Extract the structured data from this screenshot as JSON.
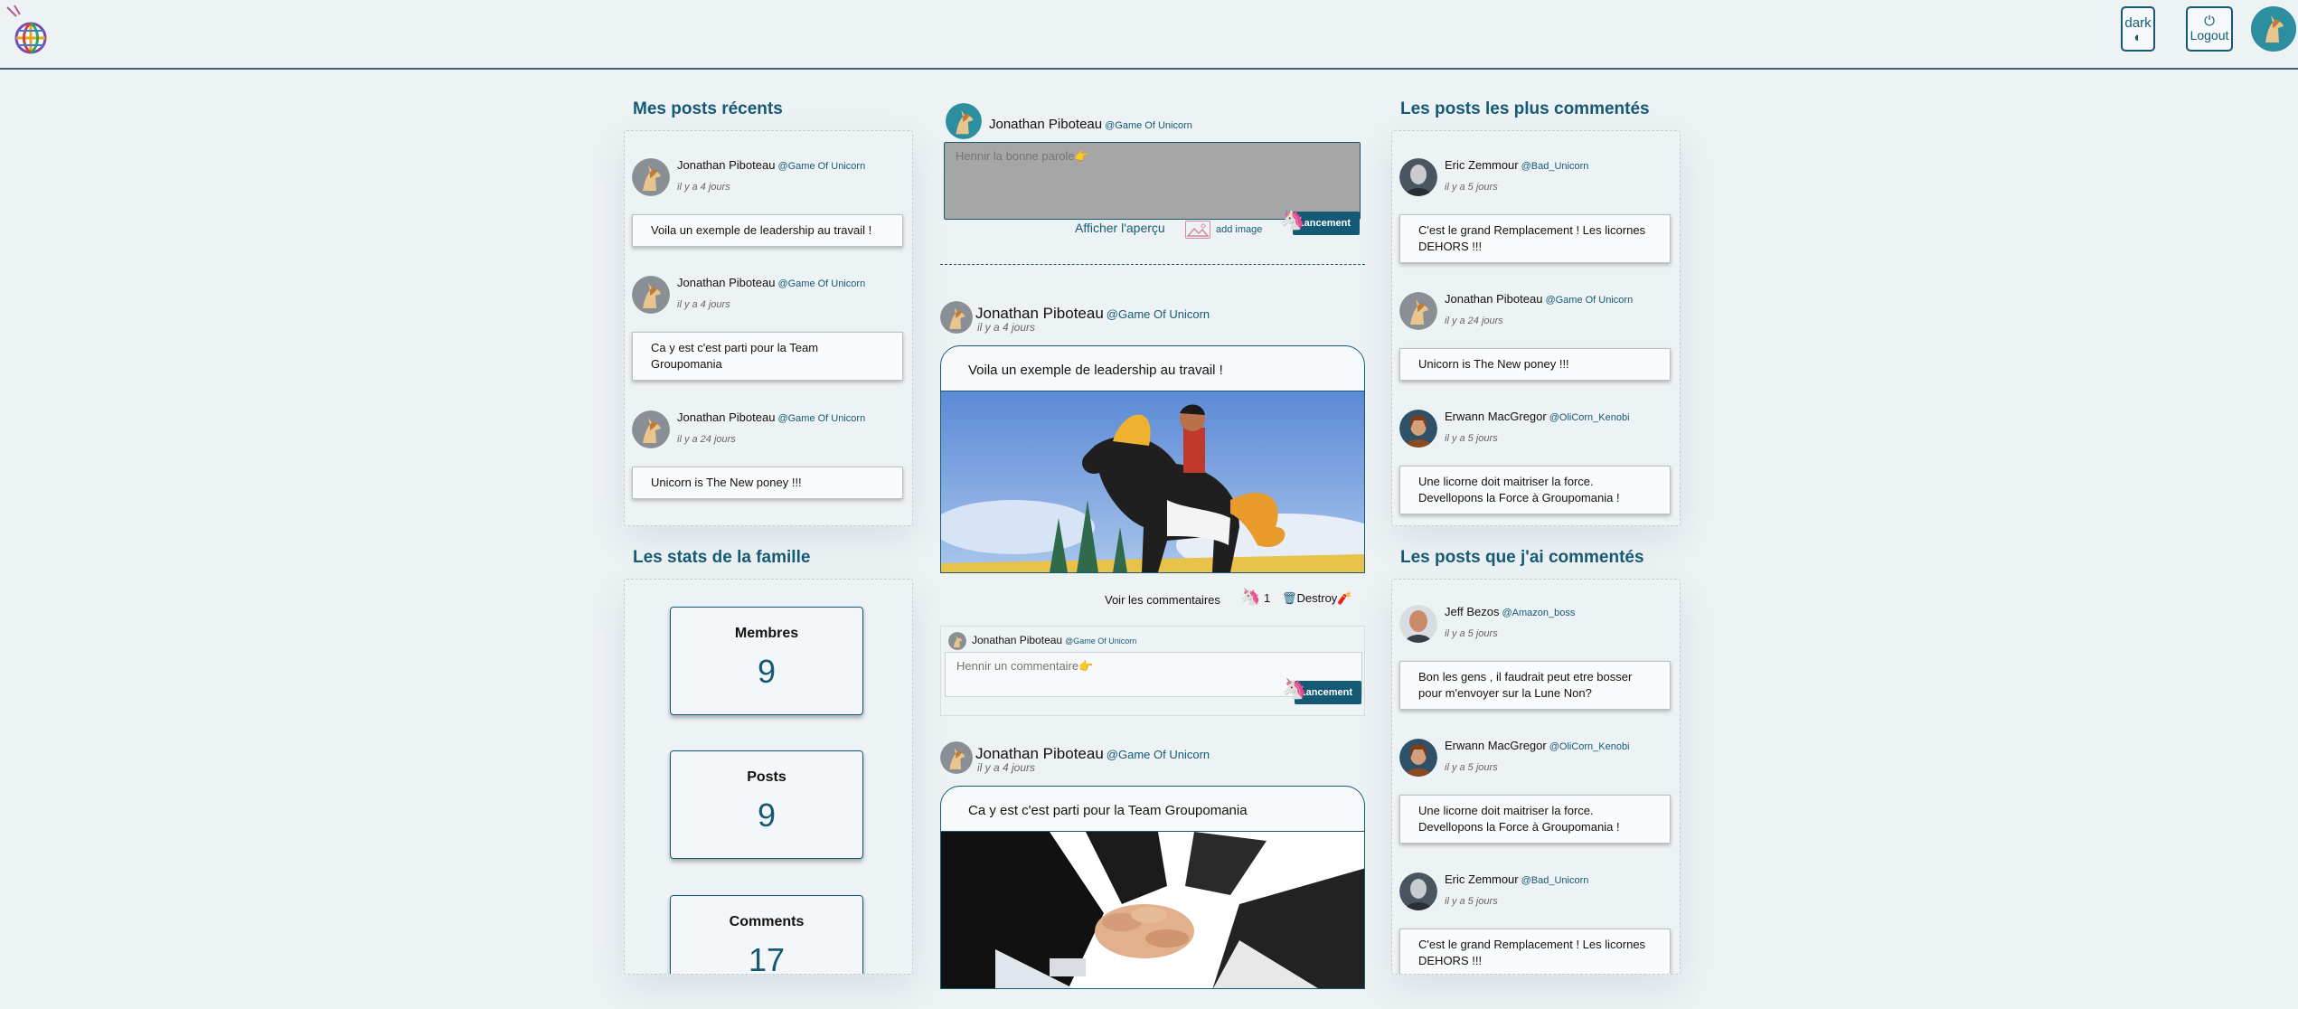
{
  "header": {
    "logo_icon": "globe-logo-icon",
    "dark_label": "dark",
    "dark_icon": "contrast-icon",
    "logout_label": "Logout",
    "logout_icon": "power-icon",
    "avatar_icon": "unicorn-avatar-icon"
  },
  "my_posts": {
    "title": "Mes posts récents",
    "items": [
      {
        "name": "Jonathan Piboteau",
        "handle": "@Game Of Unicorn",
        "time": "il y a 4 jours",
        "text": "Voila un exemple de leadership au travail !"
      },
      {
        "name": "Jonathan Piboteau",
        "handle": "@Game Of Unicorn",
        "time": "il y a 4 jours",
        "text": "Ca y est c'est parti pour la Team Groupomania"
      },
      {
        "name": "Jonathan Piboteau",
        "handle": "@Game Of Unicorn",
        "time": "il y a 24 jours",
        "text": "Unicorn is The New poney !!!"
      }
    ]
  },
  "stats": {
    "title": "Les stats de la famille",
    "members_label": "Membres",
    "members_value": "9",
    "posts_label": "Posts",
    "posts_value": "9",
    "comments_label": "Comments",
    "comments_value": "17"
  },
  "composer": {
    "name": "Jonathan Piboteau",
    "handle": "@Game Of Unicorn",
    "placeholder": "Hennir la bonne parole👉",
    "preview_label": "Afficher l'aperçu",
    "add_image_label": "add image",
    "submit_label": "Lancement"
  },
  "feed": [
    {
      "name": "Jonathan Piboteau",
      "handle": "@Game Of Unicorn",
      "time": "il y a 4 jours",
      "text": "Voila un exemple de leadership au travail !",
      "comments_label": "Voir les commentaires",
      "likes": "1",
      "destroy_label": "Destroy"
    },
    {
      "name": "Jonathan Piboteau",
      "handle": "@Game Of Unicorn",
      "time": "il y a 4 jours",
      "text": "Ca y est c'est parti pour la Team Groupomania"
    }
  ],
  "comment_box": {
    "name": "Jonathan Piboteau",
    "handle": "@Game Of Unicorn",
    "placeholder": "Hennir un commentaire👉",
    "submit_label": "Lancement"
  },
  "most_commented": {
    "title": "Les posts les plus commentés",
    "items": [
      {
        "name": "Eric Zemmour",
        "handle": "@Bad_Unicorn",
        "time": "il y a 5 jours",
        "text": "C'est le grand Remplacement ! Les licornes DEHORS !!!"
      },
      {
        "name": "Jonathan Piboteau",
        "handle": "@Game Of Unicorn",
        "time": "il y a 24 jours",
        "text": "Unicorn is The New poney !!!"
      },
      {
        "name": "Erwann MacGregor",
        "handle": "@OliCorn_Kenobi",
        "time": "il y a 5 jours",
        "text": "Une licorne doit maitriser la force. Devellopons la Force à Groupomania !"
      }
    ]
  },
  "my_comments": {
    "title": "Les posts que j'ai commentés",
    "items": [
      {
        "name": "Jeff Bezos",
        "handle": "@Amazon_boss",
        "time": "il y a 5 jours",
        "text": "Bon les gens , il faudrait peut etre bosser pour m'envoyer sur la Lune Non?"
      },
      {
        "name": "Erwann MacGregor",
        "handle": "@OliCorn_Kenobi",
        "time": "il y a 5 jours",
        "text": "Une licorne doit maitriser la force. Devellopons la Force à Groupomania !"
      },
      {
        "name": "Eric Zemmour",
        "handle": "@Bad_Unicorn",
        "time": "il y a 5 jours",
        "text": "C'est le grand Remplacement ! Les licornes DEHORS !!!"
      }
    ]
  },
  "colors": {
    "accent": "#155a75",
    "background": "#edf2f5",
    "composer_bg": "#a6a6a6"
  }
}
